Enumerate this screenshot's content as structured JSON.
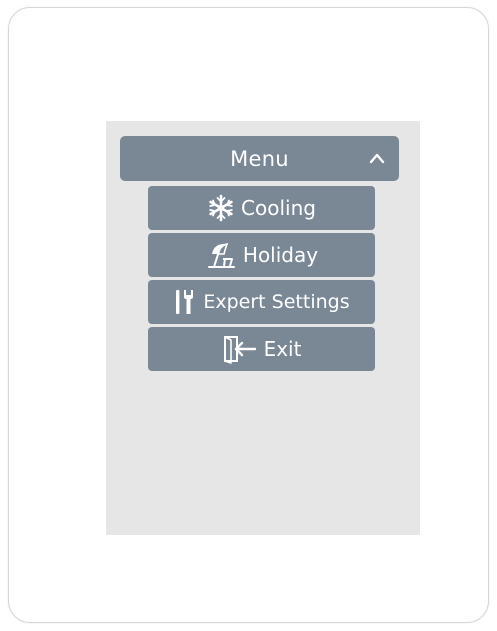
{
  "menu": {
    "title": "Menu",
    "caret_icon": "chevron-up-icon",
    "items": [
      {
        "label": "Cooling",
        "icon": "snowflake-icon"
      },
      {
        "label": "Holiday",
        "icon": "beach-umbrella-icon"
      },
      {
        "label": "Expert Settings",
        "icon": "tools-icon"
      },
      {
        "label": "Exit",
        "icon": "exit-door-icon"
      }
    ]
  },
  "colors": {
    "button": "#7a8794",
    "screen": "#e6e6e6",
    "text": "#ffffff"
  }
}
